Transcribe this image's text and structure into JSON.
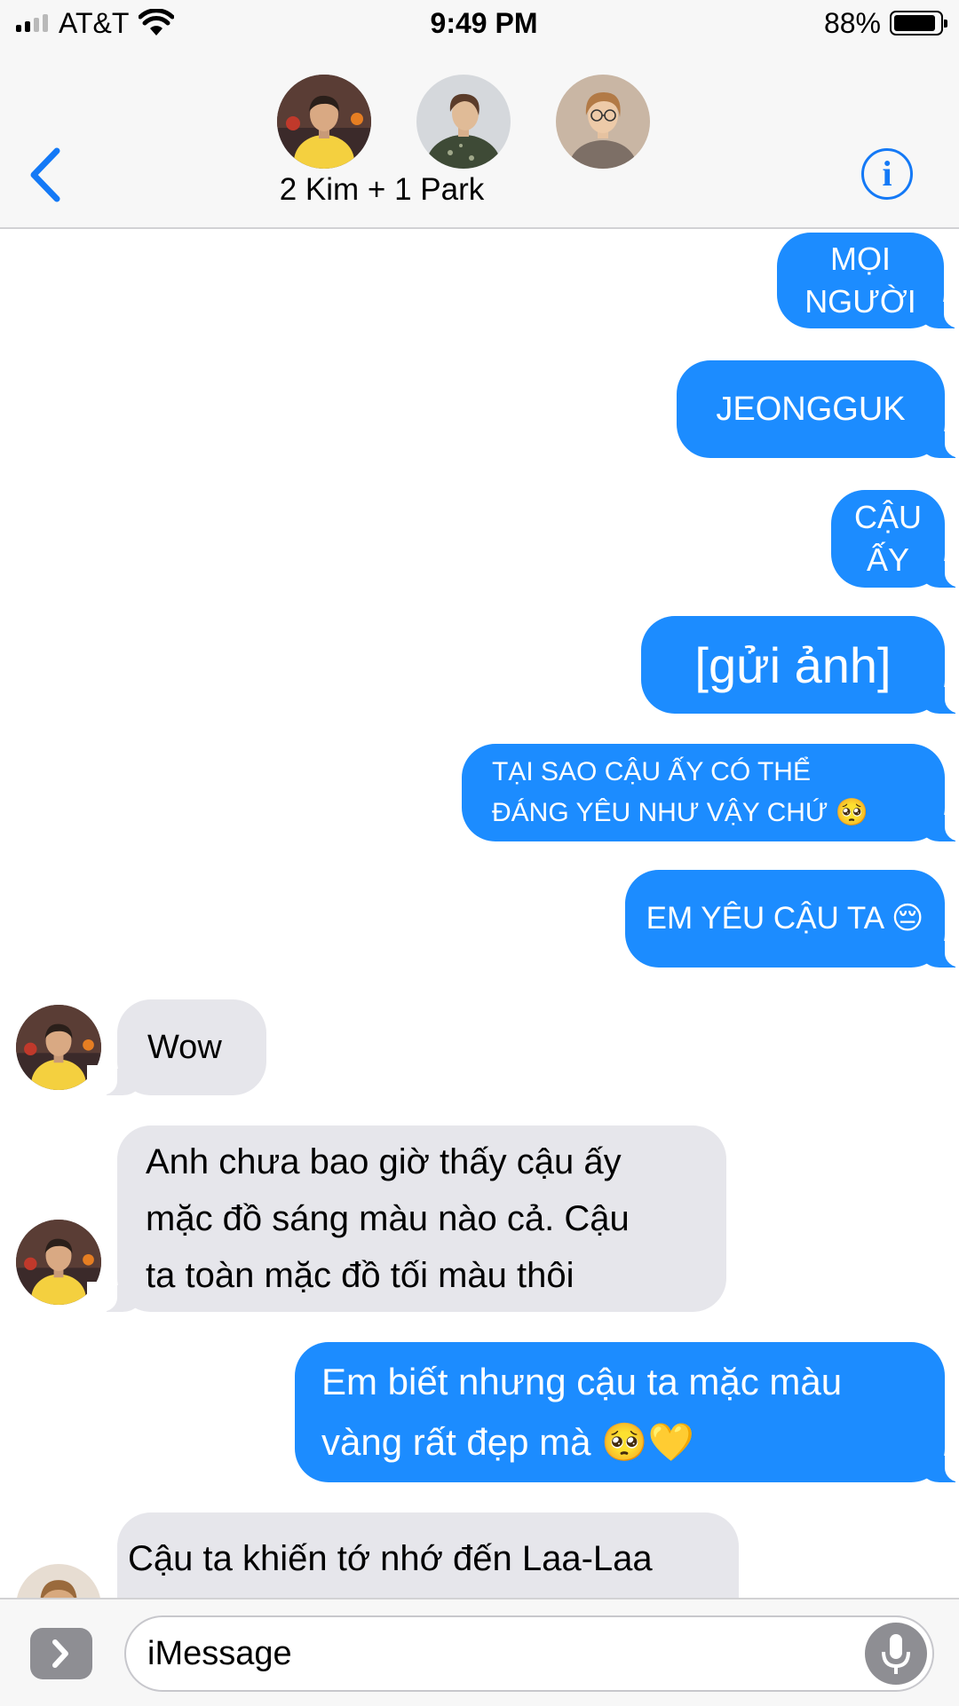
{
  "status_bar": {
    "carrier": "AT&T",
    "time": "9:49 PM",
    "battery_percent": "88%",
    "battery_level": 0.88,
    "signal_bars": 2
  },
  "header": {
    "group_name": "2 Kim + 1 Park",
    "back_icon": "chevron-left-icon",
    "info_icon": "info-icon",
    "info_glyph": "i",
    "accent_color": "#1479f6"
  },
  "messages": [
    {
      "direction": "outgoing",
      "text": "MỌI\nNGƯỜI"
    },
    {
      "direction": "outgoing",
      "text": "JEONGGUK"
    },
    {
      "direction": "outgoing",
      "text": "CẬU\nẤY"
    },
    {
      "direction": "outgoing",
      "text": "[gửi ảnh]"
    },
    {
      "direction": "outgoing",
      "text": "TẠI SAO CẬU ẤY CÓ THỂ\nĐÁNG YÊU NHƯ VẬY CHỨ",
      "emoji": "🥺"
    },
    {
      "direction": "outgoing",
      "text": "EM YÊU CẬU TA",
      "emoji": "😔"
    },
    {
      "direction": "incoming",
      "text": "Wow"
    },
    {
      "direction": "incoming",
      "text": "Anh chưa bao giờ thấy cậu ấy\nmặc đồ sáng màu nào cả. Cậu\n ta toàn mặc đồ tối màu thôi"
    },
    {
      "direction": "outgoing",
      "text": "Em biết nhưng cậu ta mặc màu\nvàng rất đẹp mà",
      "emoji": "🥺💛"
    },
    {
      "direction": "incoming",
      "text": "Cậu ta khiến  tớ  nhớ đến Laa-Laa"
    }
  ],
  "composer": {
    "placeholder": "iMessage",
    "apps_icon": "app-store-icon",
    "mic_icon": "microphone-icon"
  },
  "colors": {
    "outgoing_bubble": "#1c8cff",
    "incoming_bubble": "#e6e6eb",
    "bar_background": "#f7f7f7"
  }
}
